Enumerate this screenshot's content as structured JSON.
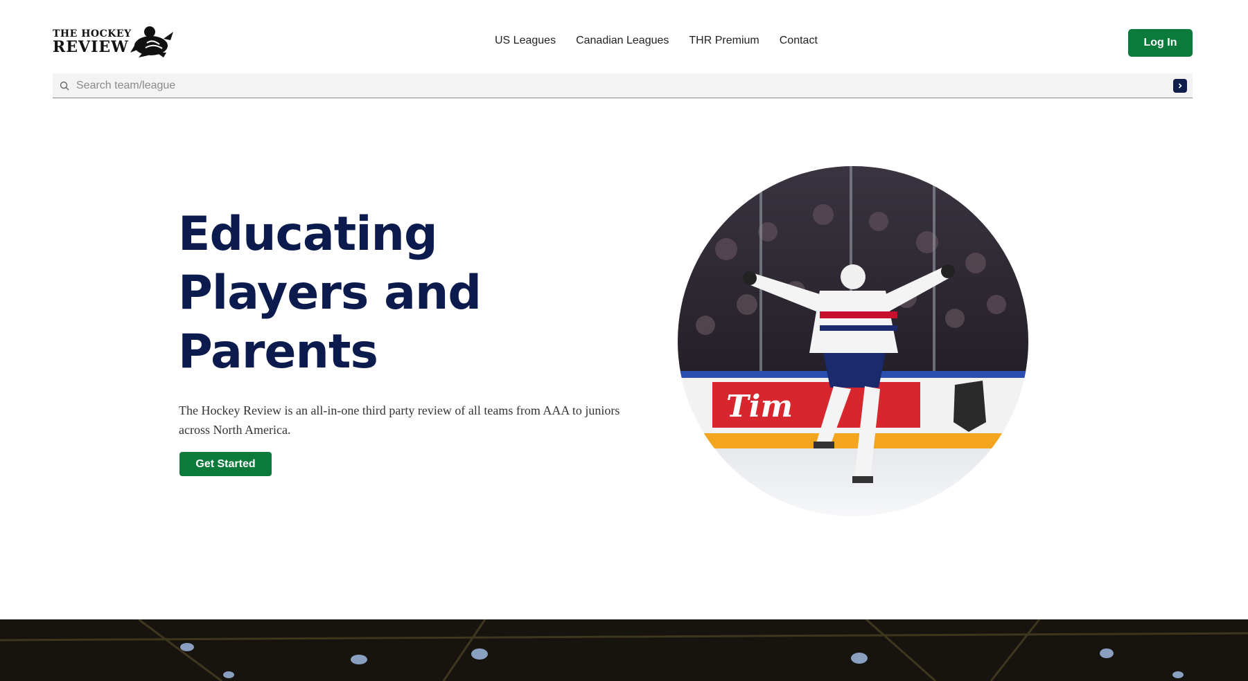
{
  "brand": {
    "logo_top": "THE HOCKEY",
    "logo_bottom": "REVIEW"
  },
  "nav": {
    "items": [
      "US Leagues",
      "Canadian Leagues",
      "THR Premium",
      "Contact"
    ]
  },
  "header": {
    "login_label": "Log In"
  },
  "search": {
    "placeholder": "Search team/league",
    "value": ""
  },
  "hero": {
    "title_lines": [
      "Educating",
      "Players and",
      "Parents"
    ],
    "subtitle": "The Hockey Review is an all-in-one third party review of all teams from AAA to juniors across North America.",
    "cta_label": "Get Started"
  },
  "colors": {
    "primary_green": "#0b7a3b",
    "navy": "#0c1b4d"
  },
  "icons": {
    "search": "search-icon",
    "submit": "chevron-right-icon"
  }
}
